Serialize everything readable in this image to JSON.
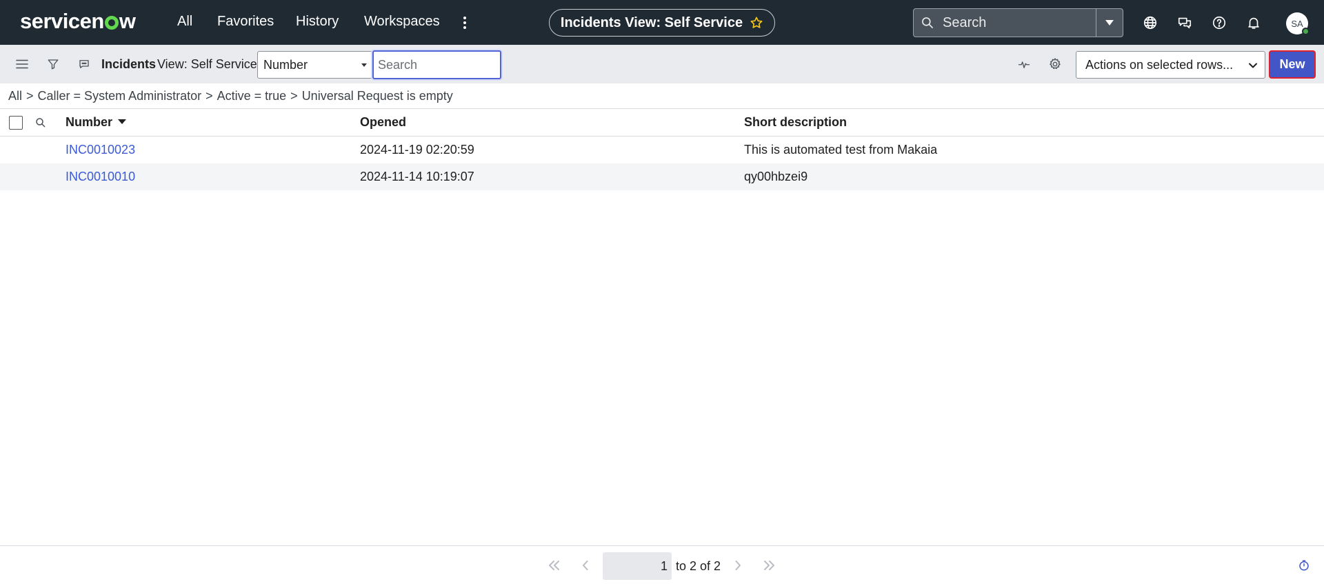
{
  "topbar": {
    "brand": "servicenow",
    "nav": [
      "All",
      "Favorites",
      "History",
      "Workspaces"
    ],
    "more_icon": "kebab-vertical-icon",
    "page_title": "Incidents View: Self Service",
    "search_placeholder": "Search",
    "user_initials": "SA"
  },
  "listbar": {
    "title": "Incidents",
    "view_label": "View: Self Service",
    "search_field": "Number",
    "search_placeholder": "Search",
    "actions_label": "Actions on selected rows...",
    "new_label": "New"
  },
  "breadcrumb": {
    "items": [
      "All",
      "Caller = System Administrator",
      "Active = true",
      "Universal Request is empty"
    ],
    "separator": ">"
  },
  "table": {
    "columns": [
      "Number",
      "Opened",
      "Short description"
    ],
    "rows": [
      {
        "number": "INC0010023",
        "opened": "2024-11-19 02:20:59",
        "short_description": "This is automated test from Makaia"
      },
      {
        "number": "INC0010010",
        "opened": "2024-11-14 10:19:07",
        "short_description": "qy00hbzei9"
      }
    ]
  },
  "pagination": {
    "current": "1",
    "summary": "to 2 of 2"
  },
  "colors": {
    "topbar_bg": "#202a33",
    "accent": "#4356c7",
    "link": "#3b5bd6",
    "brand_green": "#62d84e"
  }
}
